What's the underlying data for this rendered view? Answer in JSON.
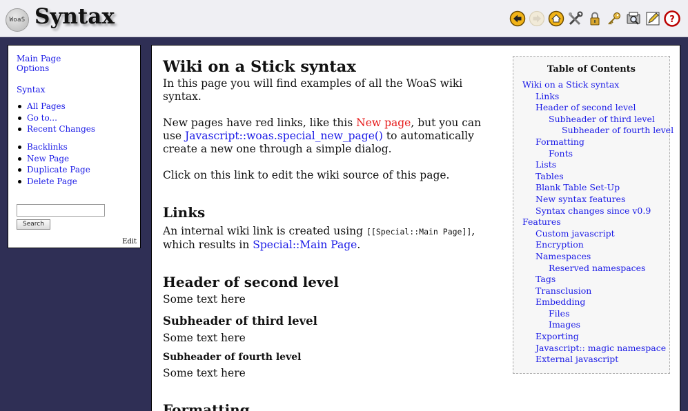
{
  "header": {
    "logo_text": "WoaS",
    "title": "Syntax",
    "toolbar": [
      {
        "icon": "back-arrow-icon",
        "label": "Back"
      },
      {
        "icon": "forward-arrow-icon",
        "label": "Forward"
      },
      {
        "icon": "home-icon",
        "label": "Home"
      },
      {
        "icon": "tools-icon",
        "label": "Advanced"
      },
      {
        "icon": "lock-icon",
        "label": "Encryption"
      },
      {
        "icon": "key-icon",
        "label": "Password"
      },
      {
        "icon": "print-search-icon",
        "label": "Print"
      },
      {
        "icon": "edit-icon",
        "label": "Edit"
      },
      {
        "icon": "help-icon",
        "label": "Help"
      }
    ]
  },
  "sidebar": {
    "top_links": [
      "Main Page",
      "Options"
    ],
    "section_link": "Syntax",
    "group1": [
      "All Pages",
      "Go to...",
      "Recent Changes"
    ],
    "group2": [
      "Backlinks",
      "New Page",
      "Duplicate Page",
      "Delete Page"
    ],
    "search_value": "",
    "search_button": "Search",
    "edit_label": "Edit"
  },
  "content": {
    "h1": "Wiki on a Stick syntax",
    "intro": "In this page you will find examples of all the WoaS wiki syntax.",
    "p2_pre": "New pages have red links, like this ",
    "p2_red": "New page",
    "p2_mid": ", but you can use ",
    "p2_link": "Javascript::woas.special_new_page()",
    "p2_post": " to automatically create a new one through a simple dialog.",
    "p3": "Click on this link to edit the wiki source of this page.",
    "links_h": "Links",
    "links_pre": "An internal wiki link is created using ",
    "links_code": "[[Special::Main Page]]",
    "links_mid": ", which results in ",
    "links_link": "Special::Main Page",
    "links_end": ".",
    "h2_second": "Header of second level",
    "text1": "Some text here",
    "h3_third": "Subheader of third level",
    "text2": "Some text here",
    "h4_fourth": "Subheader of fourth level",
    "text3": "Some text here",
    "formatting_h": "Formatting"
  },
  "toc": {
    "title": "Table of Contents",
    "items": [
      {
        "level": 1,
        "label": "Wiki on a Stick syntax"
      },
      {
        "level": 2,
        "label": "Links"
      },
      {
        "level": 2,
        "label": "Header of second level"
      },
      {
        "level": 3,
        "label": "Subheader of third level"
      },
      {
        "level": 4,
        "label": "Subheader of fourth level"
      },
      {
        "level": 2,
        "label": "Formatting"
      },
      {
        "level": 3,
        "label": "Fonts"
      },
      {
        "level": 2,
        "label": "Lists"
      },
      {
        "level": 2,
        "label": "Tables"
      },
      {
        "level": 2,
        "label": "Blank Table Set-Up"
      },
      {
        "level": 2,
        "label": "New syntax features"
      },
      {
        "level": 2,
        "label": "Syntax changes since v0.9"
      },
      {
        "level": 1,
        "label": "Features"
      },
      {
        "level": 2,
        "label": "Custom javascript"
      },
      {
        "level": 2,
        "label": "Encryption"
      },
      {
        "level": 2,
        "label": "Namespaces"
      },
      {
        "level": 3,
        "label": "Reserved namespaces"
      },
      {
        "level": 2,
        "label": "Tags"
      },
      {
        "level": 2,
        "label": "Transclusion"
      },
      {
        "level": 2,
        "label": "Embedding"
      },
      {
        "level": 3,
        "label": "Files"
      },
      {
        "level": 3,
        "label": "Images"
      },
      {
        "level": 2,
        "label": "Exporting"
      },
      {
        "level": 2,
        "label": "Javascript:: magic namespace"
      },
      {
        "level": 2,
        "label": "External javascript"
      }
    ]
  }
}
